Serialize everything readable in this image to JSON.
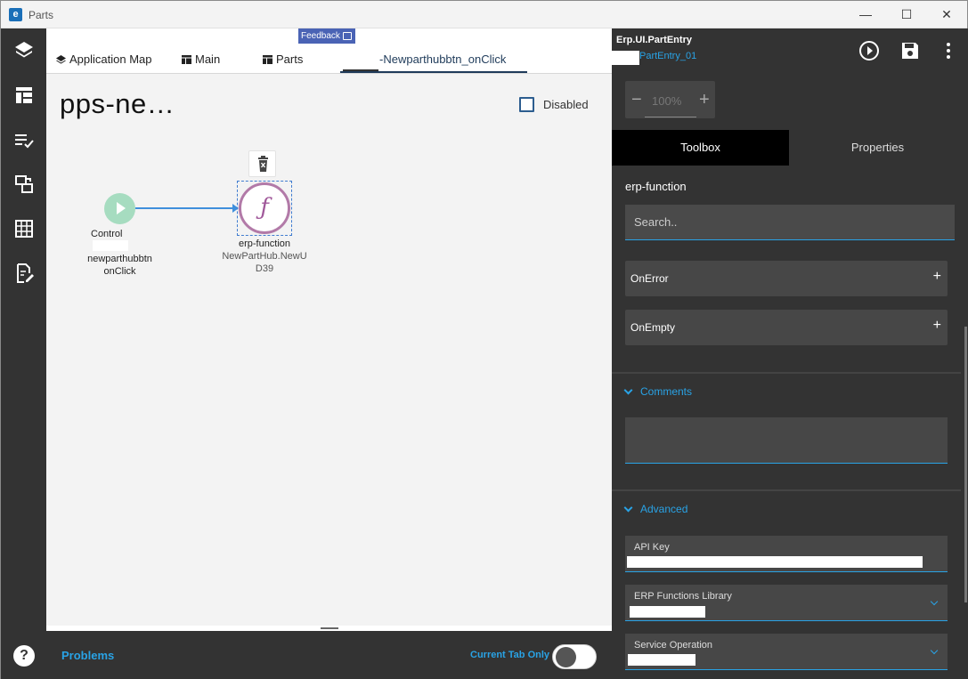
{
  "window": {
    "title": "Parts",
    "logo_letter": "e",
    "minimize": "—",
    "maximize": "☐",
    "close": "✕"
  },
  "rail": {
    "items": [
      "layers-icon",
      "layout-icon",
      "checklist-icon",
      "transfer-icon",
      "grid-icon",
      "edit-doc-icon"
    ],
    "help": "?"
  },
  "tabs": [
    {
      "label": "Application Map",
      "icon": "layers-icon"
    },
    {
      "label": "Main",
      "icon": "layout-icon"
    },
    {
      "label": "Parts",
      "icon": "layout-icon"
    },
    {
      "label": "-Newparthubbtn_onClick",
      "icon": ""
    }
  ],
  "feedback": {
    "label": "Feedback"
  },
  "canvas": {
    "title": "pps-ne…",
    "disabled_label": "Disabled",
    "start_node": {
      "label_line1": "Control",
      "label_line2": "newparthubbtn",
      "label_line3": "onClick"
    },
    "function_node": {
      "glyph": "ƒ",
      "label_line1": "erp-function",
      "label_line2": "NewPartHub.NewU",
      "label_line3": "D39"
    }
  },
  "problems": {
    "label": "Problems",
    "current_tab_label": "Current Tab Only",
    "current_tab_on": false
  },
  "panel": {
    "title": "Erp.UI.PartEntry",
    "subtitle": "PartEntry_01",
    "zoom": {
      "minus": "−",
      "value": "100%",
      "plus": "+"
    },
    "tabs": {
      "toolbox": "Toolbox",
      "properties": "Properties"
    },
    "section_title": "erp-function",
    "search_placeholder": "Search..",
    "on_error": "OnError",
    "on_empty": "OnEmpty",
    "comments_label": "Comments",
    "advanced_label": "Advanced",
    "api_key_label": "API Key",
    "erp_library_label": "ERP Functions Library",
    "service_operation_label": "Service Operation",
    "plus": "+"
  },
  "colors": {
    "accent": "#29a3e6",
    "start_node": "#a6dcc0",
    "function_node": "#b27aa8",
    "edge": "#3f8fdc",
    "feedback": "#4a63b5"
  }
}
